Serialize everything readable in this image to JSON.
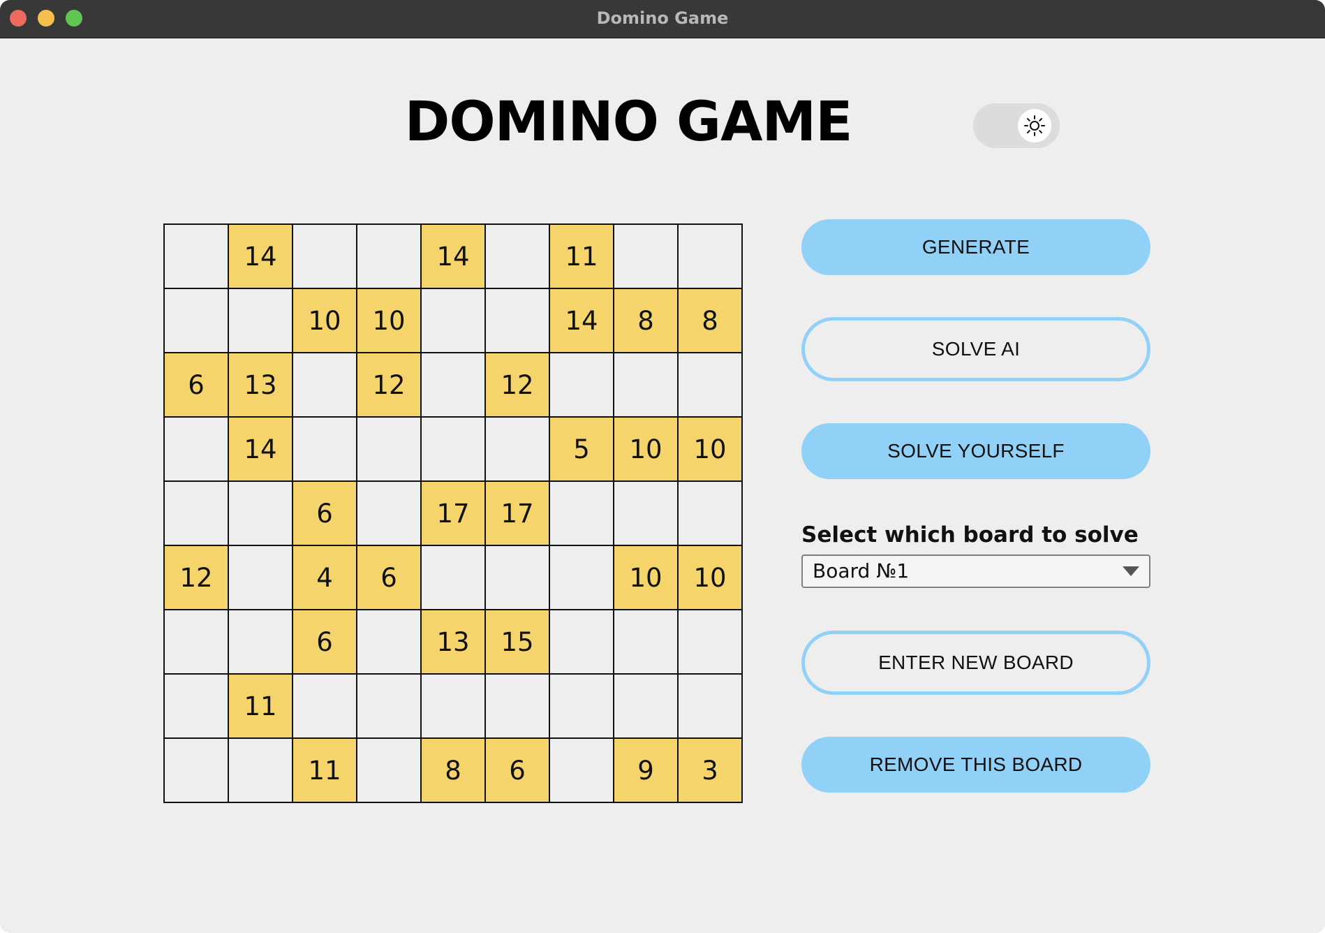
{
  "window": {
    "title": "Domino Game"
  },
  "header": {
    "title": "DOMINO GAME",
    "theme_toggle_icon": "sun-icon"
  },
  "board": {
    "rows": [
      [
        "",
        "14",
        "",
        "",
        "14",
        "",
        "11",
        "",
        ""
      ],
      [
        "",
        "",
        "10",
        "10",
        "",
        "",
        "14",
        "8",
        "8"
      ],
      [
        "6",
        "13",
        "",
        "12",
        "",
        "12",
        "",
        "",
        ""
      ],
      [
        "",
        "14",
        "",
        "",
        "",
        "",
        "5",
        "10",
        "10"
      ],
      [
        "",
        "",
        "6",
        "",
        "17",
        "17",
        "",
        "",
        ""
      ],
      [
        "12",
        "",
        "4",
        "6",
        "",
        "",
        "",
        "10",
        "10"
      ],
      [
        "",
        "",
        "6",
        "",
        "13",
        "15",
        "",
        "",
        ""
      ],
      [
        "",
        "11",
        "",
        "",
        "",
        "",
        "",
        "",
        ""
      ],
      [
        "",
        "",
        "11",
        "",
        "8",
        "6",
        "",
        "9",
        "3"
      ]
    ],
    "filled_color": "#f5d56b",
    "empty_color": "#eeeeee"
  },
  "controls": {
    "generate_label": "GENERATE",
    "solve_ai_label": "SOLVE AI",
    "solve_yourself_label": "SOLVE YOURSELF",
    "select_label": "Select which board to solve",
    "selected_board": "Board №1",
    "enter_new_board_label": "ENTER NEW BOARD",
    "remove_board_label": "REMOVE THIS BOARD",
    "accent_color": "#92d1f7"
  }
}
